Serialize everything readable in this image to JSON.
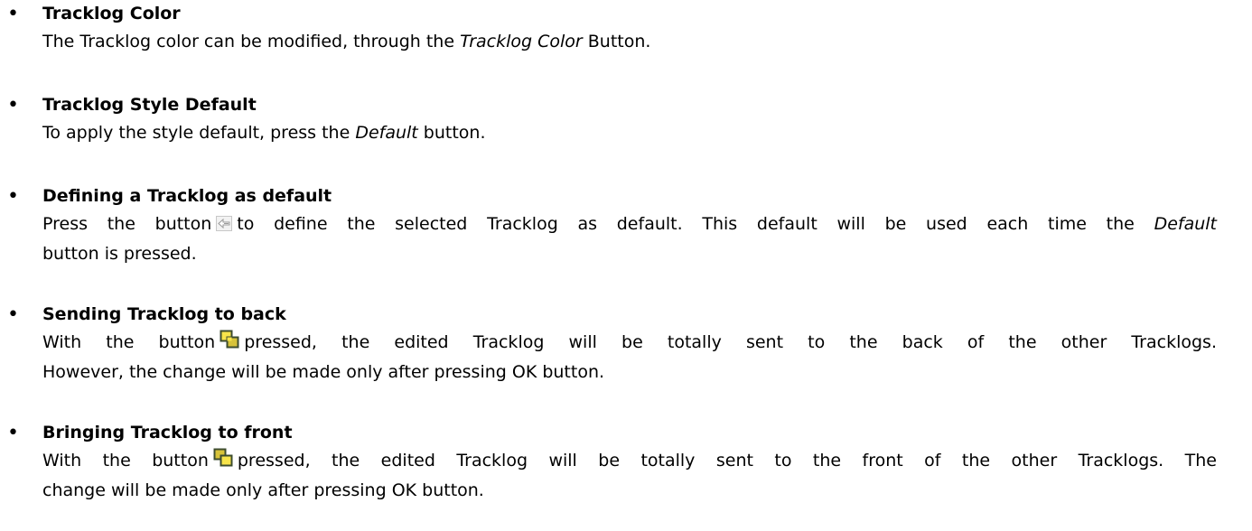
{
  "items": [
    {
      "heading": "Tracklog Color",
      "text": {
        "before": "The Tracklog color can be modified, through the ",
        "em": "Tracklog Color",
        "after": " Button."
      }
    },
    {
      "heading": "Tracklog Style Default",
      "text": {
        "before": "To apply the style default, press the ",
        "em": "Default",
        "after": " button."
      }
    },
    {
      "heading": "Defining  a Tracklog as default",
      "text": {
        "before": "Press the button",
        "icon": "set-default-arrow-icon",
        "line1_after": "to define the selected Tracklog as default. This default will be used each time the ",
        "line1_em": "Default",
        "line2": "button is pressed."
      }
    },
    {
      "heading": "Sending Tracklog to back",
      "text": {
        "before": "With the button",
        "icon": "send-to-back-icon",
        "line1_after": "pressed, the edited Tracklog will be totally sent to the back of the other Tracklogs.",
        "line2": "However, the change will be made only after pressing OK button."
      }
    },
    {
      "heading": "Bringing Tracklog to front",
      "text": {
        "before": "With the button",
        "icon": "bring-to-front-icon",
        "line1_after": "pressed, the edited Tracklog will be totally sent to the front of the other Tracklogs. The",
        "line2": "change will be made only after pressing OK button."
      }
    }
  ],
  "bullet_glyph": "•",
  "colors": {
    "text": "#000000",
    "icon_yellow": "#f7e44a",
    "icon_outline": "#3d4c2f",
    "icon_gray": "#9a9a9a"
  }
}
